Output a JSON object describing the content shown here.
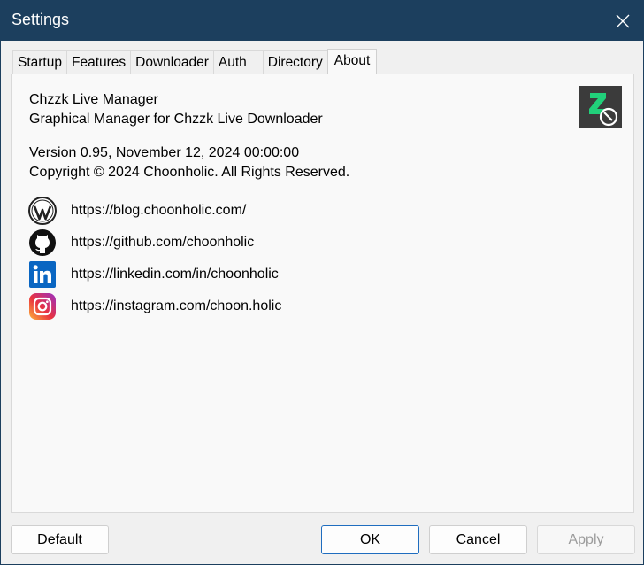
{
  "window": {
    "title": "Settings"
  },
  "tabs": [
    {
      "label": "Startup"
    },
    {
      "label": "Features"
    },
    {
      "label": "Downloader"
    },
    {
      "label": "Auth"
    },
    {
      "label": "Directory"
    },
    {
      "label": "About"
    }
  ],
  "active_tab": "About",
  "about": {
    "app_name": "Chzzk Live Manager",
    "description": "Graphical Manager for Chzzk Live Downloader",
    "version": "Version 0.95, November 12, 2024 00:00:00",
    "copyright": "Copyright © 2024 Choonholic. All Rights Reserved.",
    "links": [
      {
        "icon": "wordpress-icon",
        "url": "https://blog.choonholic.com/"
      },
      {
        "icon": "github-icon",
        "url": "https://github.com/choonholic"
      },
      {
        "icon": "linkedin-icon",
        "url": "https://linkedin.com/in/choonholic"
      },
      {
        "icon": "instagram-icon",
        "url": "https://instagram.com/choon.holic"
      }
    ]
  },
  "buttons": {
    "default": "Default",
    "ok": "OK",
    "cancel": "Cancel",
    "apply": "Apply"
  },
  "colors": {
    "titlebar": "#1c3f5e",
    "logo_bg": "#3b3b3b",
    "logo_accent": "#21d07a",
    "ok_border": "#1f6dbf",
    "linkedin": "#0a66c2"
  }
}
